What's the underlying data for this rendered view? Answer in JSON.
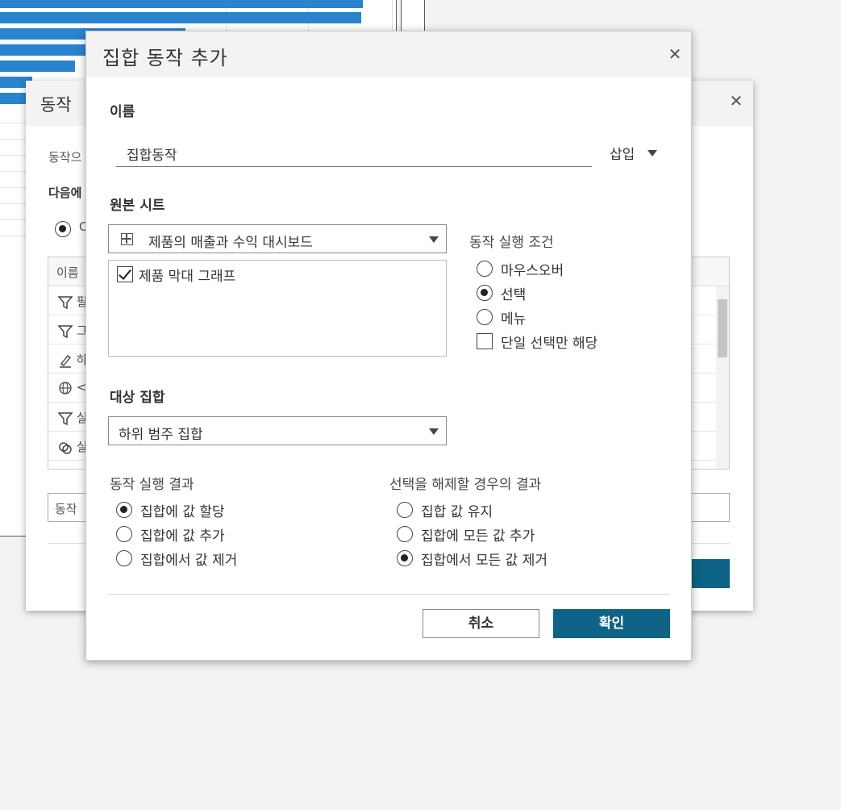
{
  "background_dialog": {
    "title": "동작",
    "description_partial": "동작으",
    "subheading_partial": "다음에",
    "radio_partial": "O",
    "table_header": "이름",
    "table_rows": [
      {
        "icon": "filter-icon",
        "text": "필"
      },
      {
        "icon": "filter-icon",
        "text": "그"
      },
      {
        "icon": "highlight-icon",
        "text": "하"
      },
      {
        "icon": "globe-icon",
        "text": "<"
      },
      {
        "icon": "filter-icon",
        "text": "실"
      },
      {
        "icon": "set-icon",
        "text": "실"
      }
    ],
    "input_partial": "동작"
  },
  "dialog": {
    "title": "집합 동작 추가",
    "name_label": "이름",
    "name_value": "집합동작",
    "insert_label": "삽입",
    "source_sheet_label": "원본 시트",
    "source_dashboard": "제품의 매출과 수익 대시보드",
    "sheets": [
      {
        "label": "제품 막대 그래프",
        "checked": true
      }
    ],
    "run_on_label": "동작 실행 조건",
    "run_on_options": [
      {
        "label": "마우스오버",
        "type": "radio",
        "checked": false
      },
      {
        "label": "선택",
        "type": "radio",
        "checked": true
      },
      {
        "label": "메뉴",
        "type": "radio",
        "checked": false
      },
      {
        "label": "단일 선택만 해당",
        "type": "checkbox",
        "checked": false
      }
    ],
    "target_set_label": "대상 집합",
    "target_set_value": "하위 범주 집합",
    "run_result_label": "동작 실행 결과",
    "run_result_options": [
      {
        "label": "집합에 값 할당",
        "checked": true
      },
      {
        "label": "집합에 값 추가",
        "checked": false
      },
      {
        "label": "집합에서 값 제거",
        "checked": false
      }
    ],
    "clear_result_label": "선택을 해제할 경우의 결과",
    "clear_result_options": [
      {
        "label": "집합 값 유지",
        "checked": false
      },
      {
        "label": "집합에 모든 값 추가",
        "checked": false
      },
      {
        "label": "집합에서 모든 값 제거",
        "checked": true
      }
    ],
    "cancel_label": "취소",
    "ok_label": "확인"
  },
  "colors": {
    "bar_blue": "#2a83cf",
    "primary_button": "#0f6386",
    "dialog_header": "#f3f3f3"
  }
}
